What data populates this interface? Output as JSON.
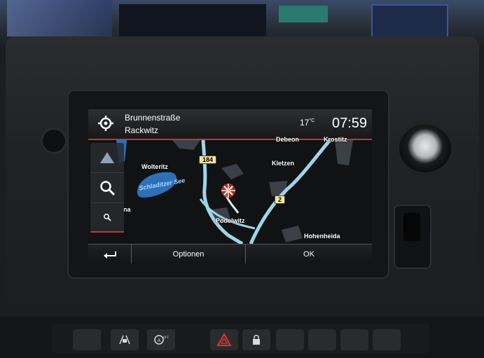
{
  "header": {
    "street": "Brunnenstraße",
    "city": "Rackwitz",
    "temperature": "17",
    "temperature_unit": "°C",
    "time": "07:59"
  },
  "map": {
    "places": [
      "Wolteritz",
      "Kletzen",
      "Podelwitz",
      "Hohenheida",
      "Krostitz",
      "Debeon"
    ],
    "lake": "Schladitzer See",
    "road_badges": [
      "184",
      "2"
    ],
    "partial_label": "na",
    "colors": {
      "background": "#101214",
      "water": "#2f6fb8",
      "road": "#9fd4e8",
      "route": "#d8eef5",
      "area": "#3b4048"
    }
  },
  "map_controls": {
    "north_icon": "triangle-up-icon",
    "zoom_in_icon": "magnifier-icon",
    "zoom_out_icon": "small-magnifier-icon"
  },
  "bottom_bar": {
    "back_icon": "back-arrow-icon",
    "options_label": "Optionen",
    "ok_label": "OK",
    "accent": "#c0392b"
  },
  "physical_controls": {
    "switch_icons": [
      "lane-assist-icon",
      "auto-start-stop-off-icon",
      "hazard-warning-icon",
      "lock-icon"
    ],
    "hazard_color": "#e0322f"
  }
}
